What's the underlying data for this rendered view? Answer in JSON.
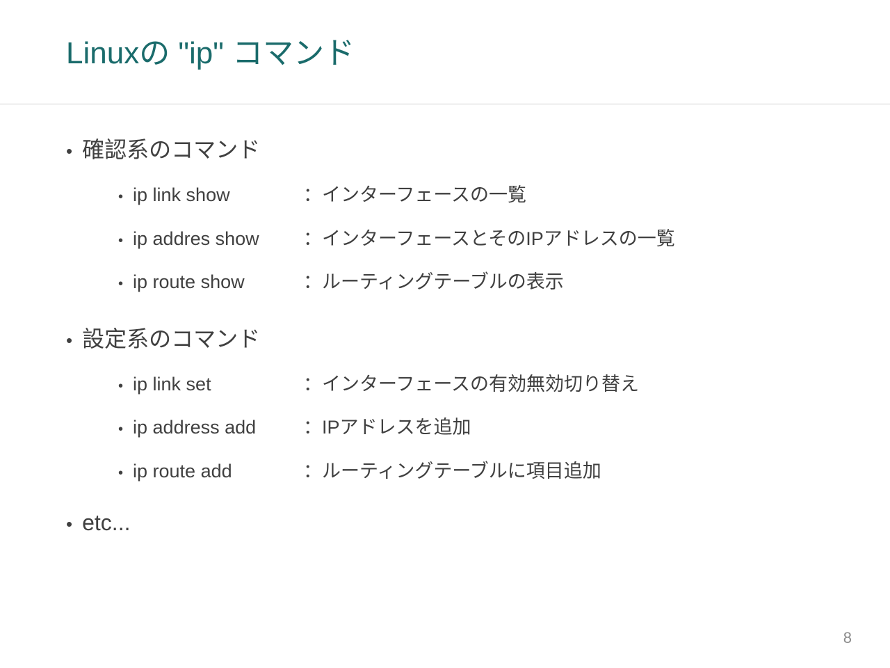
{
  "title": "Linuxの \"ip\" コマンド",
  "sections": [
    {
      "header": "確認系のコマンド",
      "items": [
        {
          "cmd": "ip link show",
          "desc": "：インターフェースの一覧"
        },
        {
          "cmd": "ip addres show",
          "desc": "：インターフェースとそのIPアドレスの一覧"
        },
        {
          "cmd": "ip route show",
          "desc": "：ルーティングテーブルの表示"
        }
      ]
    },
    {
      "header": "設定系のコマンド",
      "items": [
        {
          "cmd": "ip link set",
          "desc": "：インターフェースの有効無効切り替え"
        },
        {
          "cmd": "ip address add",
          "desc": "：IPアドレスを追加"
        },
        {
          "cmd": "ip route add",
          "desc": "：ルーティングテーブルに項目追加"
        }
      ]
    }
  ],
  "etc": "etc...",
  "page_number": "8"
}
